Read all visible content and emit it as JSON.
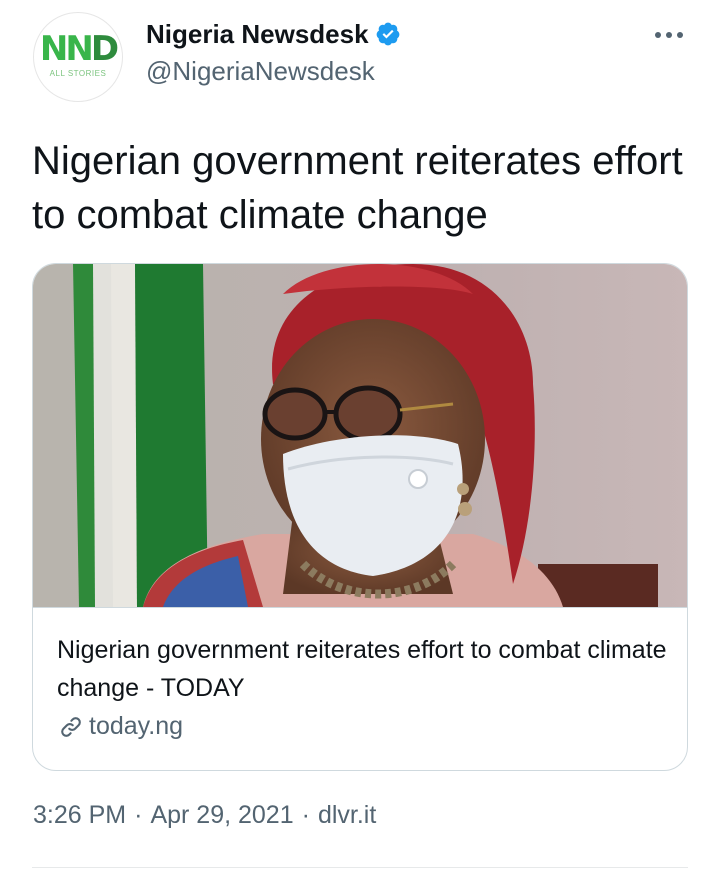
{
  "account": {
    "display_name": "Nigeria Newsdesk",
    "handle": "@NigeriaNewsdesk",
    "avatar_logo": "NND",
    "avatar_sub": "ALL STORIES",
    "verified_icon": "verified-badge-icon",
    "more_icon": "more-options-icon"
  },
  "tweet": {
    "text": "Nigerian government reiterates effort to combat climate change"
  },
  "card": {
    "image_alt": "masked-woman-photo",
    "title": "Nigerian government reiterates effort to combat climate change - TODAY",
    "domain": "today.ng",
    "link_icon": "link-icon"
  },
  "meta": {
    "time": "3:26 PM",
    "date": "Apr 29, 2021",
    "source": "dlvr.it",
    "separator": "·"
  },
  "colors": {
    "text_primary": "#0f1419",
    "text_secondary": "#536471",
    "verified_blue": "#1d9bf0",
    "border": "#cfd9de",
    "logo_green": "#39b54a"
  }
}
